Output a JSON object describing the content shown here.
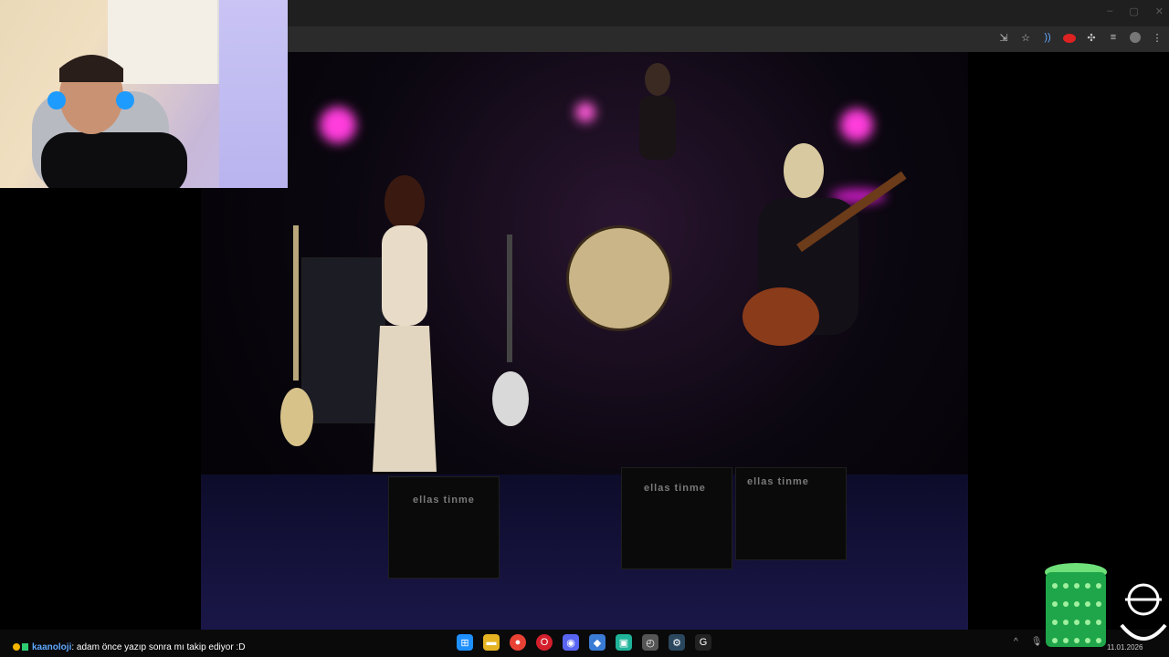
{
  "browser": {
    "window_controls": {
      "minimize": "–",
      "maximize": "▢",
      "close": "✕"
    },
    "toolbar_icons": [
      "install-app-icon",
      "bookmark-star-icon",
      "audio-playing-icon",
      "red-extension-icon",
      "extensions-puzzle-icon",
      "media-controls-icon",
      "profile-avatar-icon",
      "more-menu-icon"
    ]
  },
  "video": {
    "speaker_labels": [
      "ellas tinme",
      "ellas tinme",
      "ellas tinme"
    ]
  },
  "chat": {
    "username": "kaanoloji",
    "message": ": adam önce yazıp sonra mı takip ediyor :D"
  },
  "taskbar": {
    "apps": [
      {
        "name": "windows-start-icon",
        "glyph": "⊞",
        "color": "#1e90ff"
      },
      {
        "name": "file-explorer-icon",
        "glyph": "▬",
        "color": "#e6b422"
      },
      {
        "name": "chrome-icon",
        "glyph": "●",
        "color": "#e94235"
      },
      {
        "name": "opera-icon",
        "glyph": "O",
        "color": "#d31f2c"
      },
      {
        "name": "discord-icon",
        "glyph": "◉",
        "color": "#5865f2"
      },
      {
        "name": "app-blue-icon",
        "glyph": "◆",
        "color": "#3a7bd5"
      },
      {
        "name": "app-teal-icon",
        "glyph": "▣",
        "color": "#1fb39a"
      },
      {
        "name": "clock-app-icon",
        "glyph": "◴",
        "color": "#555555"
      },
      {
        "name": "steam-icon",
        "glyph": "⚙",
        "color": "#2a475e"
      },
      {
        "name": "g-app-icon",
        "glyph": "G",
        "color": "#222222"
      }
    ],
    "clock": "11.01.2026"
  }
}
